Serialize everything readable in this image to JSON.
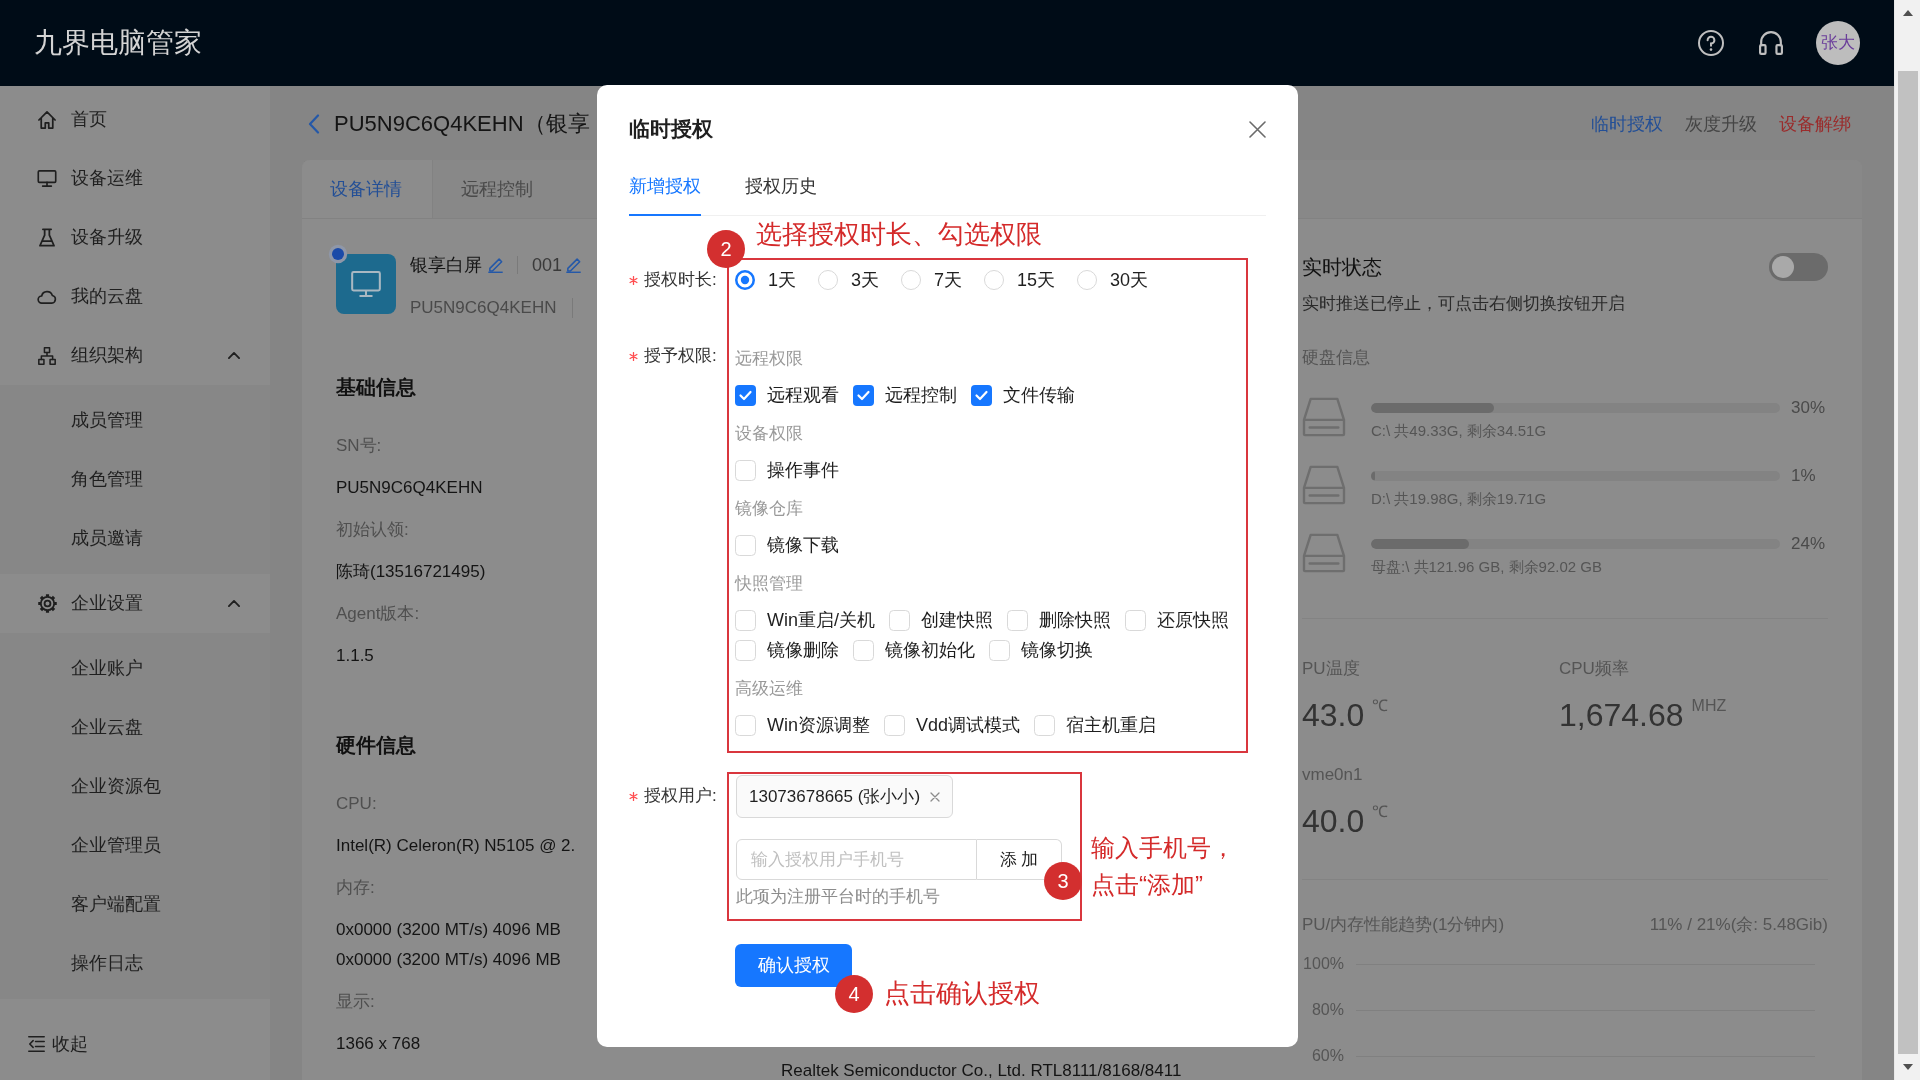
{
  "header": {
    "logo": "九界电脑管家",
    "avatar": "张大"
  },
  "sidebar": {
    "items": [
      {
        "label": "首页"
      },
      {
        "label": "设备运维"
      },
      {
        "label": "设备升级"
      },
      {
        "label": "我的云盘"
      },
      {
        "label": "组织架构",
        "expanded": true,
        "children": [
          {
            "label": "成员管理"
          },
          {
            "label": "角色管理"
          },
          {
            "label": "成员邀请"
          }
        ]
      },
      {
        "label": "企业设置",
        "expanded": true,
        "children": [
          {
            "label": "企业账户"
          },
          {
            "label": "企业云盘"
          },
          {
            "label": "企业资源包"
          },
          {
            "label": "企业管理员"
          },
          {
            "label": "客户端配置"
          },
          {
            "label": "操作日志"
          }
        ]
      }
    ],
    "collapse": "收起"
  },
  "page": {
    "title": "PU5N9C6Q4KEHN（银享",
    "actions": [
      {
        "label": "临时授权",
        "kind": "primary"
      },
      {
        "label": "灰度升级",
        "kind": "muted"
      },
      {
        "label": "设备解绑",
        "kind": "danger"
      }
    ],
    "tabs": [
      {
        "label": "设备详情",
        "selected": true
      },
      {
        "label": "远程控制",
        "selected": false
      }
    ]
  },
  "device": {
    "name": "银享白屏",
    "number": "001",
    "sn": "PU5N9C6Q4KEHN",
    "online": true
  },
  "basic_info": {
    "title": "基础信息",
    "fields": [
      {
        "label": "SN号:",
        "values": [
          "PU5N9C6Q4KEHN"
        ]
      },
      {
        "label": "初始认领:",
        "values": [
          "陈琦(13516721495)"
        ]
      },
      {
        "label": "Agent版本:",
        "values": [
          "1.1.5"
        ]
      }
    ]
  },
  "hardware_info": {
    "title": "硬件信息",
    "fields": [
      {
        "label": "CPU:",
        "values": [
          "Intel(R) Celeron(R) N5105 @ 2."
        ]
      },
      {
        "label": "内存:",
        "values": [
          "0x0000 (3200 MT/s) 4096 MB",
          "0x0000 (3200 MT/s) 4096 MB"
        ]
      },
      {
        "label": "显示:",
        "values": [
          "1366 x 768"
        ]
      }
    ],
    "column_2": [
      "Realtek Semiconductor Co., Ltd. RTL8111/8168/8411"
    ]
  },
  "realtime": {
    "title": "实时状态",
    "on": false,
    "message": "实时推送已停止，可点击右侧切换按钮开启",
    "disk_title": "硬盘信息",
    "disks": [
      {
        "level": 0.3,
        "percent": "30%",
        "detail": "C:\\ 共49.33G, 剩余34.51G"
      },
      {
        "level": 0.01,
        "percent": "1%",
        "detail": "D:\\ 共19.98G, 剩余19.71G"
      },
      {
        "level": 0.24,
        "percent": "24%",
        "detail": "母盘:\\ 共121.96 GB, 剩余92.02 GB"
      }
    ],
    "stats": [
      {
        "label": "PU温度",
        "value": "43.0",
        "unit": "℃"
      },
      {
        "label": "CPU频率",
        "value": "1,674.68",
        "unit": "MHZ"
      },
      {
        "label": "vme0n1",
        "value": "40.0",
        "unit": "℃"
      }
    ],
    "trend": {
      "title": "PU/内存性能趋势(1分钟内)",
      "summary": "11% / 21%(余: 5.48Gib)",
      "y_labels": [
        "100%",
        "80%",
        "60%"
      ]
    }
  },
  "dialog": {
    "title": "临时授权",
    "tabs": [
      {
        "label": "新增授权",
        "selected": true
      },
      {
        "label": "授权历史",
        "selected": false
      }
    ],
    "duration": {
      "label": "授权时长:",
      "required": true,
      "options": [
        {
          "label": "1天",
          "selected": true
        },
        {
          "label": "3天",
          "selected": false
        },
        {
          "label": "7天",
          "selected": false
        },
        {
          "label": "15天",
          "selected": false
        },
        {
          "label": "30天",
          "selected": false
        }
      ]
    },
    "permissions": {
      "label": "授予权限:",
      "required": true,
      "groups": [
        {
          "title": "远程权限",
          "options": [
            {
              "label": "远程观看",
              "checked": true
            },
            {
              "label": "远程控制",
              "checked": true
            },
            {
              "label": "文件传输",
              "checked": true
            }
          ]
        },
        {
          "title": "设备权限",
          "options": [
            {
              "label": "操作事件",
              "checked": false
            }
          ]
        },
        {
          "title": "镜像仓库",
          "options": [
            {
              "label": "镜像下载",
              "checked": false
            }
          ]
        },
        {
          "title": "快照管理",
          "options": [
            {
              "label": "Win重启/关机",
              "checked": false
            },
            {
              "label": "创建快照",
              "checked": false
            },
            {
              "label": "删除快照",
              "checked": false
            },
            {
              "label": "还原快照",
              "checked": false
            },
            {
              "label": "镜像删除",
              "checked": false
            },
            {
              "label": "镜像初始化",
              "checked": false
            },
            {
              "label": "镜像切换",
              "checked": false
            }
          ]
        },
        {
          "title": "高级运维",
          "options": [
            {
              "label": "Win资源调整",
              "checked": false
            },
            {
              "label": "Vdd调试模式",
              "checked": false
            },
            {
              "label": "宿主机重启",
              "checked": false
            }
          ]
        }
      ]
    },
    "users": {
      "label": "授权用户:",
      "required": true,
      "tags": [
        "13073678665 (张小小)"
      ],
      "input": {
        "placeholder": "输入授权用户手机号"
      },
      "add_button": "添 加",
      "hint": "此项为注册平台时的手机号"
    },
    "submit": "确认授权"
  },
  "annotations": [
    {
      "number": "2",
      "lines": [
        "选择授权时长、勾选权限"
      ],
      "framed": true
    },
    {
      "number": "3",
      "lines": [
        "输入手机号，",
        "点击“添加”"
      ],
      "framed": true
    },
    {
      "number": "4",
      "lines": [
        "点击确认授权"
      ]
    }
  ]
}
